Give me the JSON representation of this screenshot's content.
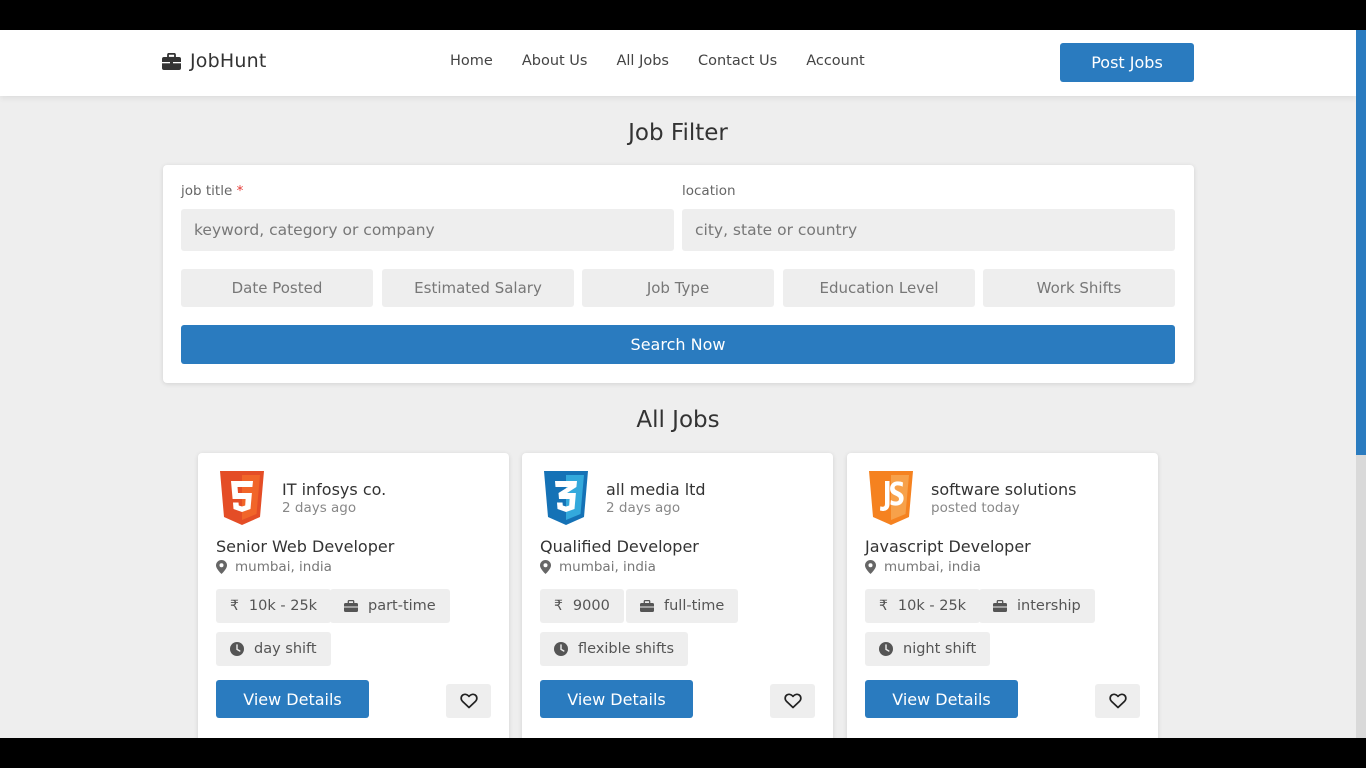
{
  "brand": {
    "name": "JobHunt",
    "icon": "briefcase-icon",
    "accent": "#2a7bbf"
  },
  "nav": {
    "items": [
      "Home",
      "About Us",
      "All Jobs",
      "Contact Us",
      "Account"
    ],
    "post_label": "Post Jobs"
  },
  "filter": {
    "title": "Job Filter",
    "job_title_label": "job title",
    "required_mark": "*",
    "job_title_placeholder": "keyword, category or company",
    "location_label": "location",
    "location_placeholder": "city, state or country",
    "options": [
      "Date Posted",
      "Estimated Salary",
      "Job Type",
      "Education Level",
      "Work Shifts"
    ],
    "search_label": "Search Now"
  },
  "jobs_section": {
    "title": "All Jobs"
  },
  "jobs": [
    {
      "logo": "html5-icon",
      "company": "IT infosys co.",
      "posted": "2 days ago",
      "title": "Senior Web Developer",
      "location": "mumbai, india",
      "salary": "10k - 25k",
      "type": "part-time",
      "shift": "day shift",
      "view_label": "View Details",
      "fav_icon": "heart-icon"
    },
    {
      "logo": "css3-icon",
      "company": "all media ltd",
      "posted": "2 days ago",
      "title": "Qualified Developer",
      "location": "mumbai, india",
      "salary": "9000",
      "type": "full-time",
      "shift": "flexible shifts",
      "view_label": "View Details",
      "fav_icon": "heart-icon"
    },
    {
      "logo": "js-icon",
      "company": "software solutions",
      "posted": "posted today",
      "title": "Javascript Developer",
      "location": "mumbai, india",
      "salary": "10k - 25k",
      "type": "intership",
      "shift": "night shift",
      "view_label": "View Details",
      "fav_icon": "heart-icon"
    }
  ],
  "currency_symbol": "₹"
}
